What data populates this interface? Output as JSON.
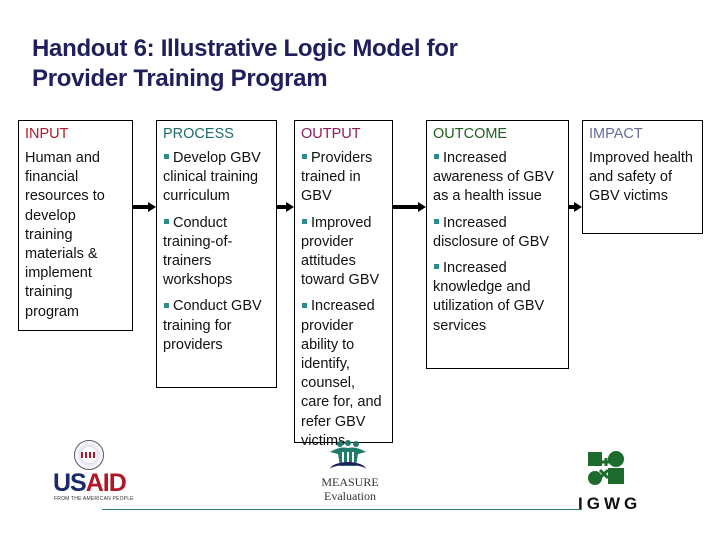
{
  "title": {
    "line1": "Handout 6: Illustrative Logic Model for",
    "line2": "Provider Training Program"
  },
  "colors": {
    "title": "#1f1f5c",
    "input_head": "#b0182a",
    "process_head": "#1f6b6b",
    "output_head": "#8b1a5a",
    "outcome_head": "#1e5e1e",
    "impact_head": "#6a6a9a",
    "bullet": "#2e8b8b",
    "footer_rule": "#2e7b7b"
  },
  "columns": {
    "input": {
      "heading": "INPUT",
      "text": "Human and financial resources to develop training materials & implement training program"
    },
    "process": {
      "heading": "PROCESS",
      "items": [
        "Develop GBV clinical training curriculum",
        "Conduct training-of-trainers workshops",
        "Conduct GBV training for providers"
      ]
    },
    "output": {
      "heading": "OUTPUT",
      "items": [
        "Providers trained in GBV",
        "Improved provider attitudes toward GBV",
        "Increased provider ability to identify, counsel, care for, and refer GBV victims"
      ]
    },
    "outcome": {
      "heading": "OUTCOME",
      "items": [
        "Increased awareness of GBV as a health issue",
        "Increased disclosure of GBV",
        "Increased knowledge and utilization of GBV services"
      ]
    },
    "impact": {
      "heading": "IMPACT",
      "text": "Improved health and safety of GBV victims"
    }
  },
  "logos": {
    "usaid": {
      "word_us": "US",
      "word_aid": "AID",
      "tagline": "FROM THE AMERICAN PEOPLE"
    },
    "measure": {
      "line1": "MEASURE",
      "line2": "Evaluation"
    },
    "igwg": {
      "word": "IGWG"
    }
  }
}
